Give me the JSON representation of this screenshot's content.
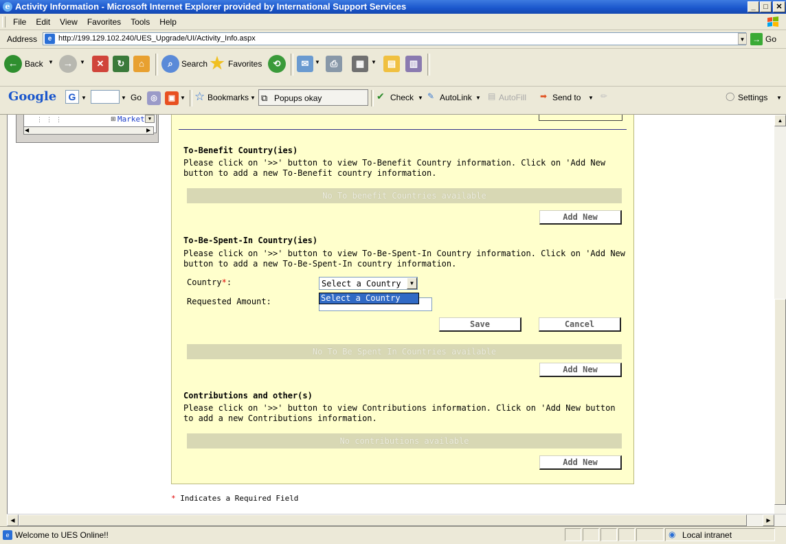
{
  "window": {
    "title": "Activity Information - Microsoft Internet Explorer provided by International Support Services",
    "min": "_",
    "max": "□",
    "close": "✕"
  },
  "menu": [
    "File",
    "Edit",
    "View",
    "Favorites",
    "Tools",
    "Help"
  ],
  "address": {
    "label": "Address",
    "url": "http://199.129.102.240/UES_Upgrade/UI/Activity_Info.aspx",
    "go": "Go"
  },
  "toolbar": {
    "back": "Back",
    "search": "Search",
    "favorites": "Favorites"
  },
  "googlebar": {
    "logo": "Google",
    "go": "Go",
    "bookmarks": "Bookmarks",
    "popups": "Popups okay",
    "check": "Check",
    "autolink": "AutoLink",
    "autofill": "AutoFill",
    "sendto": "Send to",
    "settings": "Settings"
  },
  "tree": {
    "item": "Market"
  },
  "benefit": {
    "heading": "To-Benefit Country(ies)",
    "instructions": "Please click on '>>' button to view To-Benefit Country information. Click on 'Add New button to add a new To-Benefit country information.",
    "empty": "No To benefit Countries available",
    "add_new": "Add New"
  },
  "spent": {
    "heading": "To-Be-Spent-In Country(ies)",
    "instructions": "Please click on '>>' button to view To-Be-Spent-In Country information. Click on 'Add New button to add a new To-Be-Spent-In country information.",
    "country_label": "Country",
    "required_mark": "*",
    "country_colon": ":",
    "country_value": "Select a Country",
    "dropdown_option": "Select a Country",
    "amount_label": "Requested Amount:",
    "amount_value": "",
    "save": "Save",
    "cancel": "Cancel",
    "empty": "No To Be Spent In Countries available",
    "add_new": "Add New"
  },
  "contrib": {
    "heading": "Contributions and other(s)",
    "instructions": "Please click on '>>' button to view Contributions information. Click on 'Add New button to add a new Contributions information.",
    "empty": "No contributions available",
    "add_new": "Add New"
  },
  "required_note": {
    "mark": "*",
    "text": " Indicates a Required Field"
  },
  "status": {
    "message": "Welcome to UES Online!!",
    "zone": "Local intranet"
  }
}
